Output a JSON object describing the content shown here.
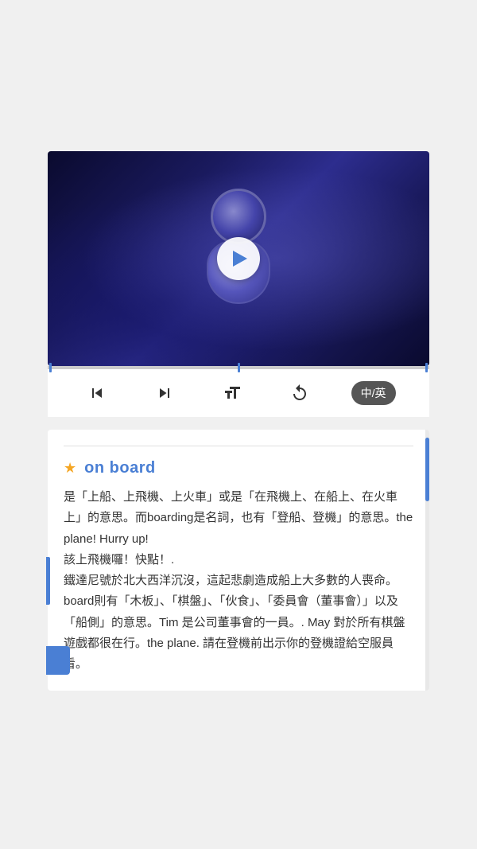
{
  "page": {
    "background_color": "#f0f0f0"
  },
  "video": {
    "play_button_label": "▶",
    "progress_percent": 0
  },
  "controls": {
    "skip_back_label": "⏮",
    "skip_forward_label": "⏭",
    "font_label": "A",
    "replay_label": "↺",
    "lang_label": "中/英"
  },
  "word_card": {
    "star": "★",
    "title": "on board",
    "definition": "是「上船、上飛機、上火車」或是「在飛機上、在船上、在火車上」的意思。而boarding是名詞，也有「登船、登機」的意思。the plane! Hurry up!\n該上飛機囉！快點！.\n鐵達尼號於北大西洋沉沒，這起悲劇造成船上大多數的人喪命。board則有「木板」、「棋盤」、「伙食」、「委員會（董事會）」以及「船側」的意思。Tim 是公司董事會的一員。. May 對於所有棋盤遊戲都很在行。the plane. 請在登機前出示你的登機證給空服員看。"
  }
}
